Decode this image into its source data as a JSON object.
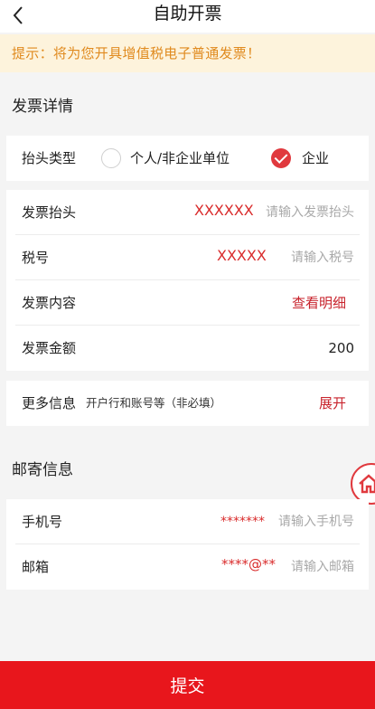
{
  "header": {
    "title": "自助开票"
  },
  "tip": {
    "text": "提示：将为您开具增值税电子普通发票！"
  },
  "invoice_section": {
    "title": "发票详情",
    "header_type": {
      "label": "抬头类型",
      "options": [
        "个人/非企业单位",
        "企业"
      ],
      "selected": "企业"
    },
    "fields": {
      "title_label": "发票抬头",
      "title_value": "XXXXXX",
      "title_placeholder": "请输入发票抬头",
      "tax_label": "税号",
      "tax_value": "XXXXX",
      "tax_placeholder": "请输入税号",
      "content_label": "发票内容",
      "content_link": "查看明细",
      "amount_label": "发票金额",
      "amount_value": "200"
    },
    "more": {
      "label": "更多信息",
      "hint": "开户行和账号等（非必填）",
      "expand_label": "展开"
    }
  },
  "mail_section": {
    "title": "邮寄信息",
    "phone_label": "手机号",
    "phone_value": "*******",
    "phone_placeholder": "请输入手机号",
    "email_label": "邮箱",
    "email_value": "****@**",
    "email_placeholder": "请输入邮箱"
  },
  "submit_label": "提交",
  "colors": {
    "accent": "#e8161c",
    "tip_bg": "#fdf3dc",
    "tip_text": "#e08a1e"
  },
  "icons": {
    "back": "chevron-left-icon",
    "check": "check-icon",
    "home": "home-icon"
  }
}
